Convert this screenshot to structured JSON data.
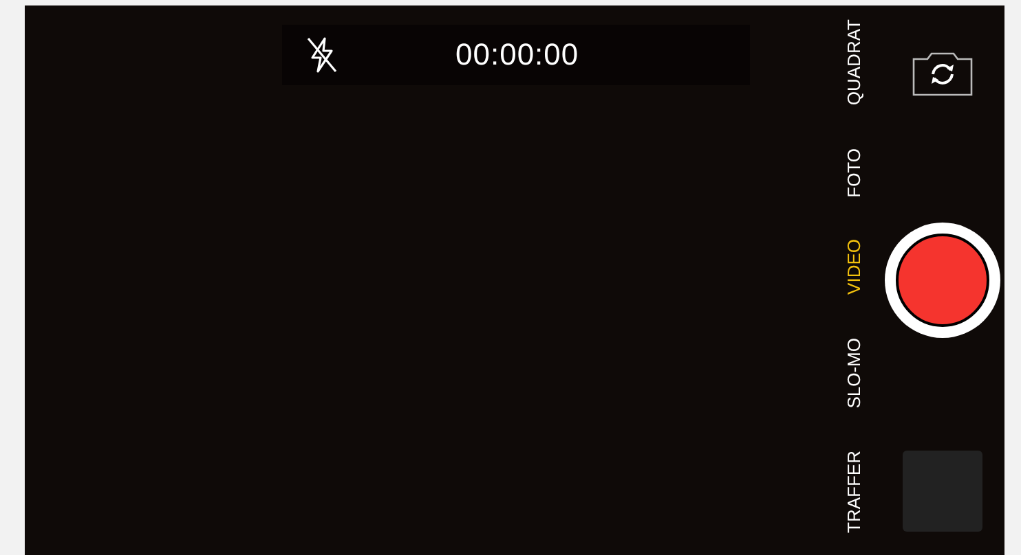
{
  "top_bar": {
    "timer": "00:00:00"
  },
  "modes": [
    {
      "label": "QUADRAT",
      "selected": false
    },
    {
      "label": "FOTO",
      "selected": false
    },
    {
      "label": "VIDEO",
      "selected": true
    },
    {
      "label": "SLO-MO",
      "selected": false
    },
    {
      "label": "TRAFFER",
      "selected": false
    }
  ]
}
